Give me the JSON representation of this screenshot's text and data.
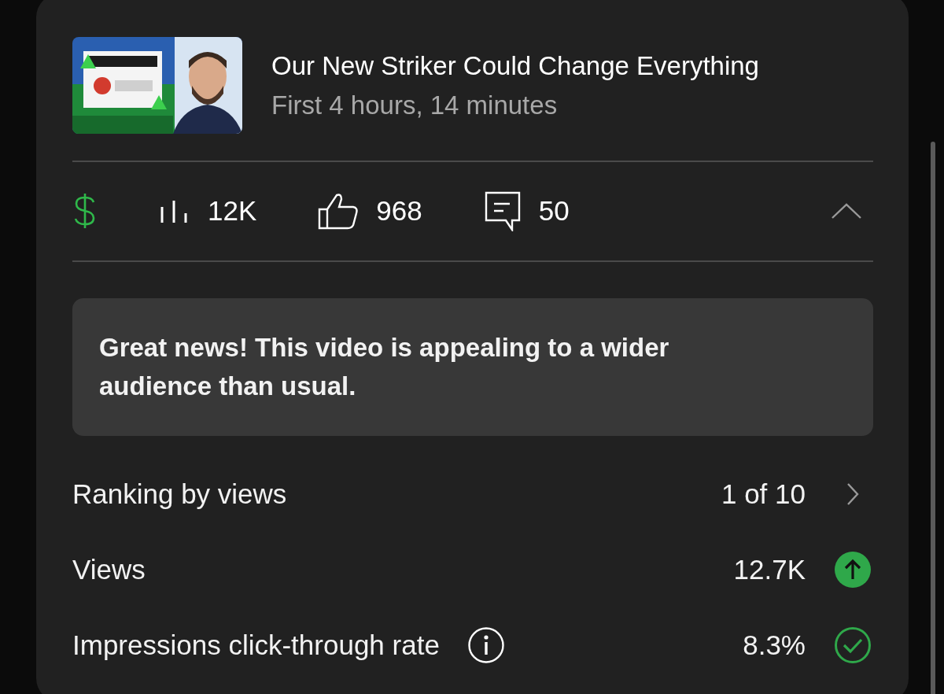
{
  "video": {
    "title": "Our New Striker Could Change Everything",
    "subtitle": "First 4 hours, 14 minutes"
  },
  "stats": [
    {
      "kind": "revenue"
    },
    {
      "kind": "views",
      "value": "12K"
    },
    {
      "kind": "likes",
      "value": "968"
    },
    {
      "kind": "comments",
      "value": "50"
    }
  ],
  "expanded": true,
  "banner": "Great news! This video is appealing to a wider audience than usual.",
  "metrics": [
    {
      "label": "Ranking by views",
      "value": "1 of 10",
      "kind": "link",
      "info": false
    },
    {
      "label": "Views",
      "value": "12.7K",
      "kind": "trend-up",
      "info": false
    },
    {
      "label": "Impressions click-through rate",
      "value": "8.3%",
      "kind": "good",
      "info": true
    }
  ]
}
